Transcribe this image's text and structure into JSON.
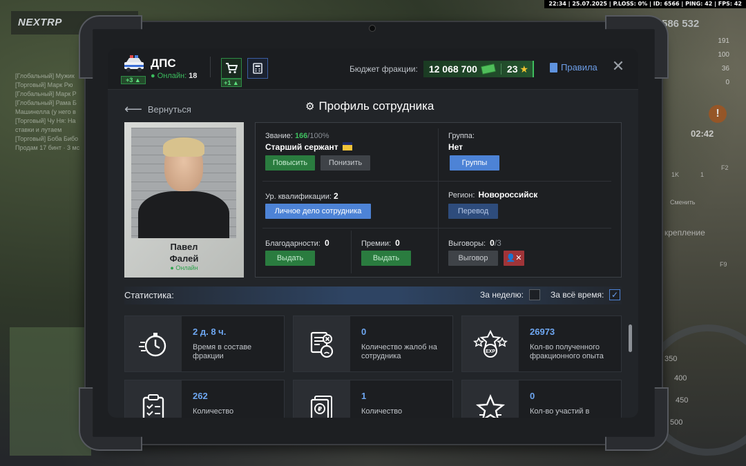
{
  "hud": {
    "top_bar": "22:34 | 25.07.2025 | P.LOSS: 0% | ID: 6566 | PING: 42 | FPS: 42",
    "logo": "NEXTRP",
    "money": "586 532",
    "side_stats": [
      "191",
      "100",
      "36",
      "0"
    ],
    "timer": "02:42",
    "chat_lines": [
      "[Глобальный] Мужик",
      "[Торговый] Марк Рю",
      "[Глобальный] Марк Р",
      "[Глобальный] Рама Б",
      "Машинелла (у него в",
      "[Торговый] Чу Ня: На",
      "ставки и лутаем",
      "[Торговый] Боба Бибо",
      "Продам 17 бинт · 3 мс"
    ],
    "chips": [
      "1K",
      "1",
      "F2",
      "Сменить",
      "крепление",
      "F9"
    ],
    "speed_marks": [
      "350",
      "400",
      "450",
      "500"
    ]
  },
  "header": {
    "faction_name": "ДПС",
    "faction_plus": "+3",
    "online_label": "Онлайн:",
    "online_count": "18",
    "cart_plus": "+1",
    "budget_label": "Бюджет фракции:",
    "budget_value": "12 068 700",
    "stars_value": "23",
    "rules_label": "Правила"
  },
  "nav": {
    "back_label": "Вернуться",
    "page_title": "Профиль сотрудника"
  },
  "employee": {
    "first_name": "Павел",
    "last_name": "Фалей",
    "status": "Онлайн"
  },
  "info": {
    "rank_label": "Звание:",
    "rank_progress": "166",
    "rank_max": "/100%",
    "rank_name": "Старший сержант",
    "promote_label": "Повысить",
    "demote_label": "Понизить",
    "group_label": "Группа:",
    "group_value": "Нет",
    "groups_button": "Группы",
    "qual_label": "Ур. квалификации:",
    "qual_value": "2",
    "personal_file_button": "Личное дело сотрудника",
    "region_label": "Регион:",
    "region_value": "Новороссийск",
    "transfer_button": "Перевод",
    "thanks_label": "Благодарности:",
    "thanks_value": "0",
    "thanks_button": "Выдать",
    "bonus_label": "Премии:",
    "bonus_value": "0",
    "bonus_button": "Выдать",
    "reprimand_label": "Выговоры:",
    "reprimand_value": "0",
    "reprimand_max": "/3",
    "reprimand_button": "Выговор"
  },
  "statistics": {
    "title": "Статистика:",
    "week_label": "За неделю:",
    "alltime_label": "За всё время:",
    "week_checked": false,
    "alltime_checked": true,
    "cards": [
      {
        "value": "2 д. 8 ч.",
        "label": "Время в составе фракции",
        "icon": "stopwatch-icon"
      },
      {
        "value": "0",
        "label": "Количество жалоб на сотрудника",
        "icon": "complaint-icon"
      },
      {
        "value": "26973",
        "label": "Кол-во полученного фракционного опыта",
        "icon": "exp-icon"
      },
      {
        "value": "262",
        "label": "Количество",
        "icon": "clipboard-icon"
      },
      {
        "value": "1",
        "label": "Количество",
        "icon": "ruble-document-icon"
      },
      {
        "value": "0",
        "label": "Кол-во участий в",
        "icon": "star-icon"
      }
    ]
  },
  "colors": {
    "accent_blue": "#4d83d6",
    "accent_green": "#2a7c3f",
    "danger": "#a03438",
    "gold": "#f2c531"
  }
}
